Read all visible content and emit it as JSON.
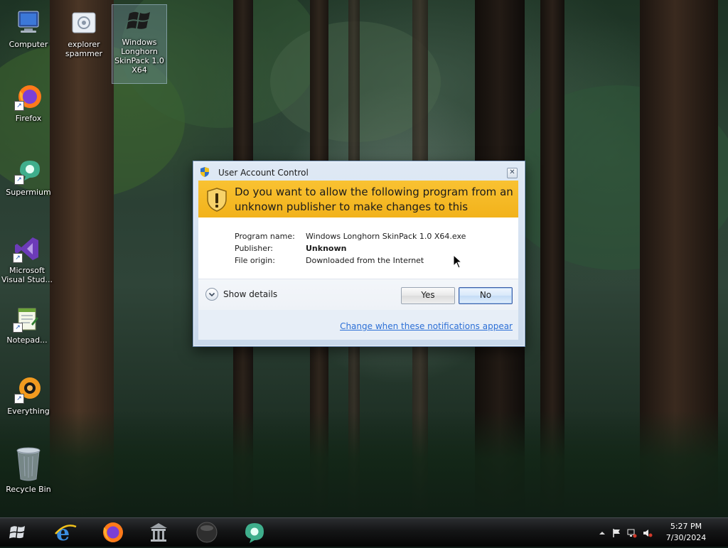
{
  "desktop": {
    "icons": [
      {
        "label": "Computer",
        "icon": "computer-icon"
      },
      {
        "label": "explorer spammer",
        "icon": "program-icon"
      },
      {
        "label": "Windows Longhorn SkinPack 1.0 X64",
        "icon": "windows-flag-icon"
      },
      {
        "label": "Firefox",
        "icon": "firefox-icon"
      },
      {
        "label": "Supermium",
        "icon": "supermium-icon"
      },
      {
        "label": "Microsoft Visual Stud...",
        "icon": "visual-studio-icon"
      },
      {
        "label": "Notepad...",
        "icon": "notepad-icon"
      },
      {
        "label": "Everything",
        "icon": "everything-icon"
      },
      {
        "label": "Recycle Bin",
        "icon": "recycle-bin-icon"
      }
    ]
  },
  "uac": {
    "title": "User Account Control",
    "close_glyph": "✕",
    "question": "Do you want to allow the following program from an unknown publisher to make changes to this computer?",
    "fields": [
      {
        "label": "Program name:",
        "value": "Windows Longhorn SkinPack 1.0 X64.exe"
      },
      {
        "label": "Publisher:",
        "value": "Unknown"
      },
      {
        "label": "File origin:",
        "value": "Downloaded from the Internet"
      }
    ],
    "details_label": "Show details",
    "yes_label": "Yes",
    "no_label": "No",
    "link_label": "Change when these notifications appear",
    "colors": {
      "banner": "#f2b21b",
      "link": "#2c6fd6"
    }
  },
  "taskbar": {
    "pinned": [
      "internet-explorer-icon",
      "firefox-icon",
      "file-manager-icon",
      "media-player-icon",
      "supermium-icon"
    ],
    "clock": {
      "time": "5:27 PM",
      "date": "7/30/2024"
    }
  }
}
